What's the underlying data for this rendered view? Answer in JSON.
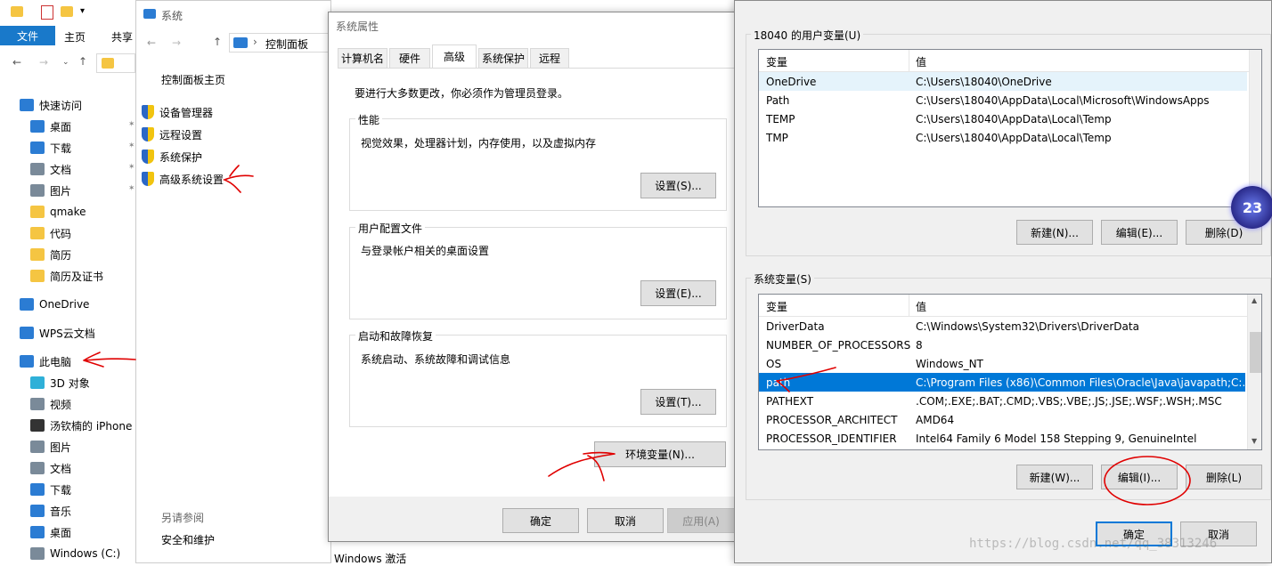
{
  "explorer": {
    "ribbon_tabs": [
      "文件",
      "主页",
      "共享"
    ],
    "nav": [
      {
        "label": "快速访问",
        "icon": "star-icon"
      },
      {
        "label": "桌面",
        "icon": "desktop-icon"
      },
      {
        "label": "下载",
        "icon": "download-icon"
      },
      {
        "label": "文档",
        "icon": "document-icon"
      },
      {
        "label": "图片",
        "icon": "picture-icon"
      },
      {
        "label": "qmake",
        "icon": "folder-icon"
      },
      {
        "label": "代码",
        "icon": "folder-icon"
      },
      {
        "label": "简历",
        "icon": "folder-icon"
      },
      {
        "label": "简历及证书",
        "icon": "folder-icon"
      },
      {
        "label": "OneDrive",
        "icon": "cloud-icon"
      },
      {
        "label": "WPS云文档",
        "icon": "cloud-outline-icon"
      },
      {
        "label": "此电脑",
        "icon": "computer-icon"
      },
      {
        "label": "3D 对象",
        "icon": "cube-icon"
      },
      {
        "label": "视频",
        "icon": "video-icon"
      },
      {
        "label": "汤钦楠的 iPhone",
        "icon": "phone-icon"
      },
      {
        "label": "图片",
        "icon": "picture-icon"
      },
      {
        "label": "文档",
        "icon": "document-icon"
      },
      {
        "label": "下载",
        "icon": "download-icon"
      },
      {
        "label": "音乐",
        "icon": "music-icon"
      },
      {
        "label": "桌面",
        "icon": "desktop-icon"
      },
      {
        "label": "Windows (C:)",
        "icon": "drive-icon"
      }
    ]
  },
  "system": {
    "title": "系统",
    "breadcrumb": "控制面板",
    "home": "控制面板主页",
    "links": [
      "设备管理器",
      "远程设置",
      "系统保护",
      "高级系统设置"
    ],
    "see_also": "另请参阅",
    "security": "安全和维护"
  },
  "props": {
    "title": "系统属性",
    "tabs": [
      "计算机名",
      "硬件",
      "高级",
      "系统保护",
      "远程"
    ],
    "admin_note": "要进行大多数更改，你必须作为管理员登录。",
    "perf": {
      "title": "性能",
      "desc": "视觉效果，处理器计划，内存使用，以及虚拟内存",
      "btn": "设置(S)..."
    },
    "profile": {
      "title": "用户配置文件",
      "desc": "与登录帐户相关的桌面设置",
      "btn": "设置(E)..."
    },
    "startup": {
      "title": "启动和故障恢复",
      "desc": "系统启动、系统故障和调试信息",
      "btn": "设置(T)..."
    },
    "env_btn": "环境变量(N)...",
    "ok": "确定",
    "cancel": "取消",
    "apply": "应用(A)",
    "activation": "Windows 激活"
  },
  "env": {
    "user_title": "18040 的用户变量(U)",
    "col_var": "变量",
    "col_val": "值",
    "user_vars": [
      {
        "name": "OneDrive",
        "value": "C:\\Users\\18040\\OneDrive"
      },
      {
        "name": "Path",
        "value": "C:\\Users\\18040\\AppData\\Local\\Microsoft\\WindowsApps"
      },
      {
        "name": "TEMP",
        "value": "C:\\Users\\18040\\AppData\\Local\\Temp"
      },
      {
        "name": "TMP",
        "value": "C:\\Users\\18040\\AppData\\Local\\Temp"
      }
    ],
    "user_new": "新建(N)...",
    "user_edit": "编辑(E)...",
    "user_del": "删除(D)",
    "sys_title": "系统变量(S)",
    "sys_vars": [
      {
        "name": "DriverData",
        "value": "C:\\Windows\\System32\\Drivers\\DriverData"
      },
      {
        "name": "NUMBER_OF_PROCESSORS",
        "value": "8"
      },
      {
        "name": "OS",
        "value": "Windows_NT"
      },
      {
        "name": "path",
        "value": "C:\\Program Files (x86)\\Common Files\\Oracle\\Java\\javapath;C:..."
      },
      {
        "name": "PATHEXT",
        "value": ".COM;.EXE;.BAT;.CMD;.VBS;.VBE;.JS;.JSE;.WSF;.WSH;.MSC"
      },
      {
        "name": "PROCESSOR_ARCHITECT",
        "value": "AMD64"
      },
      {
        "name": "PROCESSOR_IDENTIFIER",
        "value": "Intel64 Family 6 Model 158 Stepping 9, GenuineIntel"
      }
    ],
    "sys_new": "新建(W)...",
    "sys_edit": "编辑(I)...",
    "sys_del": "删除(L)",
    "ok": "确定",
    "cancel": "取消",
    "watermark": "https://blog.csdn.net/qq_38313246",
    "badge": "23"
  },
  "colors": {
    "accent": "#0078d7",
    "annotation": "#e00000"
  }
}
